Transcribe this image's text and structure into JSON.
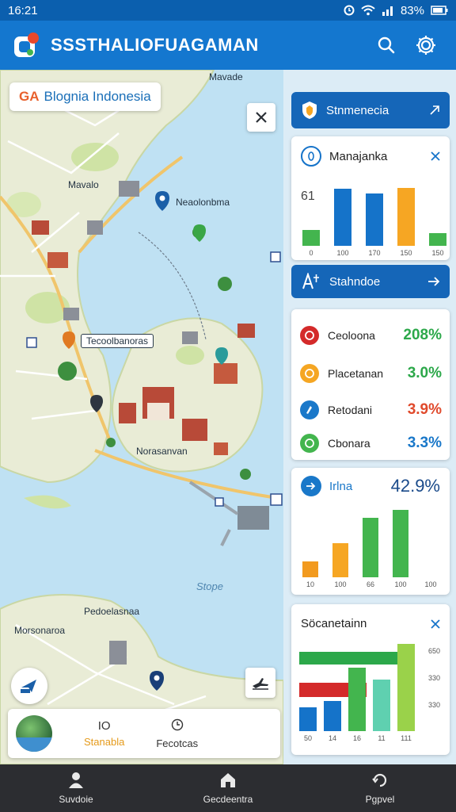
{
  "status": {
    "time": "16:21",
    "battery": "83%"
  },
  "app": {
    "title": "SSSTHALIOFUAGAMAN"
  },
  "map": {
    "location_pill_prefix": "GA",
    "location_pill": "Blognia Indonesia",
    "labels": [
      "Mavade",
      "Mavalo",
      "Neaolonbma",
      "Tecoolbanoras",
      "Norasanvan",
      "Stope",
      "Pedoelasnaa",
      "Morsonaroa"
    ]
  },
  "info_card": {
    "col1_top": "IO",
    "col1_bottom": "Stanabla",
    "col2_bottom": "Fecotcas"
  },
  "panel": {
    "card1": {
      "label": "Stnmenecia",
      "icon": "shield-icon"
    },
    "card2": {
      "title": "Manajanka",
      "ylabel": "61",
      "ticks": [
        "0",
        "100",
        "170",
        "150",
        "150"
      ],
      "bar_colors": [
        "#43b54e",
        "#1573c9",
        "#1573c9",
        "#f6a623",
        "#43b54e"
      ]
    },
    "card3": {
      "label": "Stahndoe"
    },
    "stats": [
      {
        "name": "Ceoloona",
        "value": "208%",
        "color": "#2ca84a",
        "icon_color": "#d42a2a"
      },
      {
        "name": "Placetanan",
        "value": "3.0%",
        "color": "#2ca84a",
        "icon_color": "#f5a623"
      },
      {
        "name": "Retodani",
        "value": "3.9%",
        "color": "#e04a2c",
        "icon_color": "#1a78c9"
      },
      {
        "name": "Cbonara",
        "value": "3.3%",
        "color": "#1a78c9",
        "icon_color": "#43b54e"
      }
    ],
    "card5": {
      "label": "Irlna",
      "value": "42.9%",
      "ticks": [
        "10",
        "100",
        "66",
        "100",
        "100"
      ],
      "bar_colors": [
        "#f29a1f",
        "#f6a623",
        "#43b54e",
        "#43b54e"
      ]
    },
    "card6": {
      "title": "Söcanetainn",
      "ticks_y": [
        "650",
        "330",
        "330"
      ],
      "ticks_x": [
        "50",
        "14",
        "16",
        "11",
        "111"
      ]
    }
  },
  "chart_data": [
    {
      "type": "bar",
      "title": "Manajanka",
      "categories": [
        "0",
        "100",
        "170",
        "150",
        "150"
      ],
      "values": [
        20,
        72,
        66,
        73,
        16
      ]
    },
    {
      "type": "bar",
      "title": "Irlna",
      "categories": [
        "10",
        "100",
        "66",
        "100",
        "100"
      ],
      "values": [
        20,
        43,
        75,
        85
      ]
    },
    {
      "type": "bar",
      "title": "Söcanetainn",
      "categories": [
        "50",
        "14",
        "16",
        "11",
        "111"
      ],
      "series": [
        {
          "values": [
            30,
            38,
            80,
            65,
            110
          ]
        },
        {
          "values": [
            75,
            75,
            80
          ]
        },
        {
          "values": [
            100,
            100,
            100,
            100
          ]
        }
      ]
    }
  ],
  "nav": [
    {
      "label": "Suvdoie",
      "icon": "person-icon"
    },
    {
      "label": "Gecdeentra",
      "icon": "home-icon"
    },
    {
      "label": "Pgpvel",
      "icon": "refresh-icon"
    }
  ]
}
